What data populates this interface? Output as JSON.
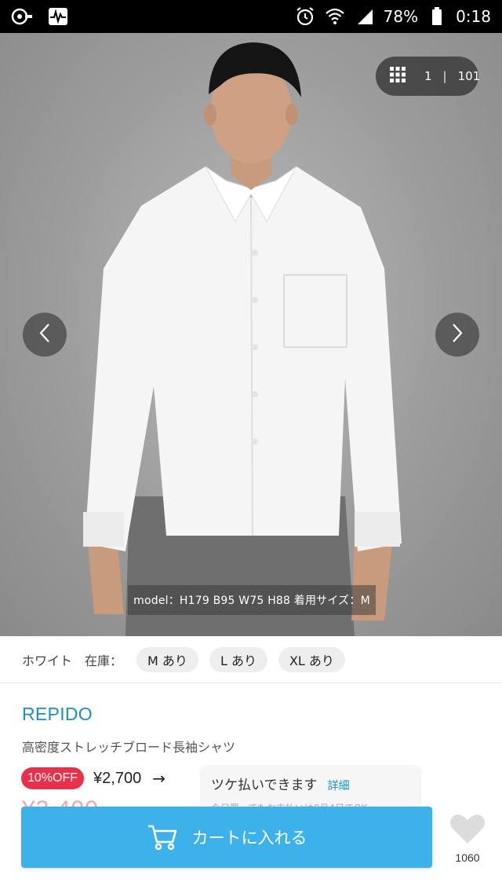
{
  "status_bar": {
    "battery": "78%",
    "time": "0:18",
    "icons": [
      "key-icon",
      "pulse-icon",
      "alarm-icon",
      "wifi-icon",
      "signal-icon",
      "battery-icon"
    ]
  },
  "gallery": {
    "current": "1",
    "separator": "|",
    "total": "101",
    "caption": "model：H179 B95 W75 H88 着用サイズ：M"
  },
  "stock": {
    "color": "ホワイト",
    "label": "在庫：",
    "sizes": [
      "M あり",
      "L あり",
      "XL あり"
    ]
  },
  "product": {
    "brand": "REPIDO",
    "name": "高密度ストレッチブロード長袖シャツ",
    "discount_badge": "10%OFF",
    "price": "¥2,700",
    "arrow": "→",
    "old_price": "¥3,400"
  },
  "tooltip": {
    "title": "ツケ払いできます",
    "link": "詳細",
    "subtitle": "今日買ってもお支払いは8月4日でOK"
  },
  "cart": {
    "label": "カートに入れる"
  },
  "favorite": {
    "count": "1060"
  },
  "colors": {
    "accent_blue": "#3db2ea",
    "brand_blue": "#1a8fd0",
    "sale_red": "#e8304b"
  }
}
